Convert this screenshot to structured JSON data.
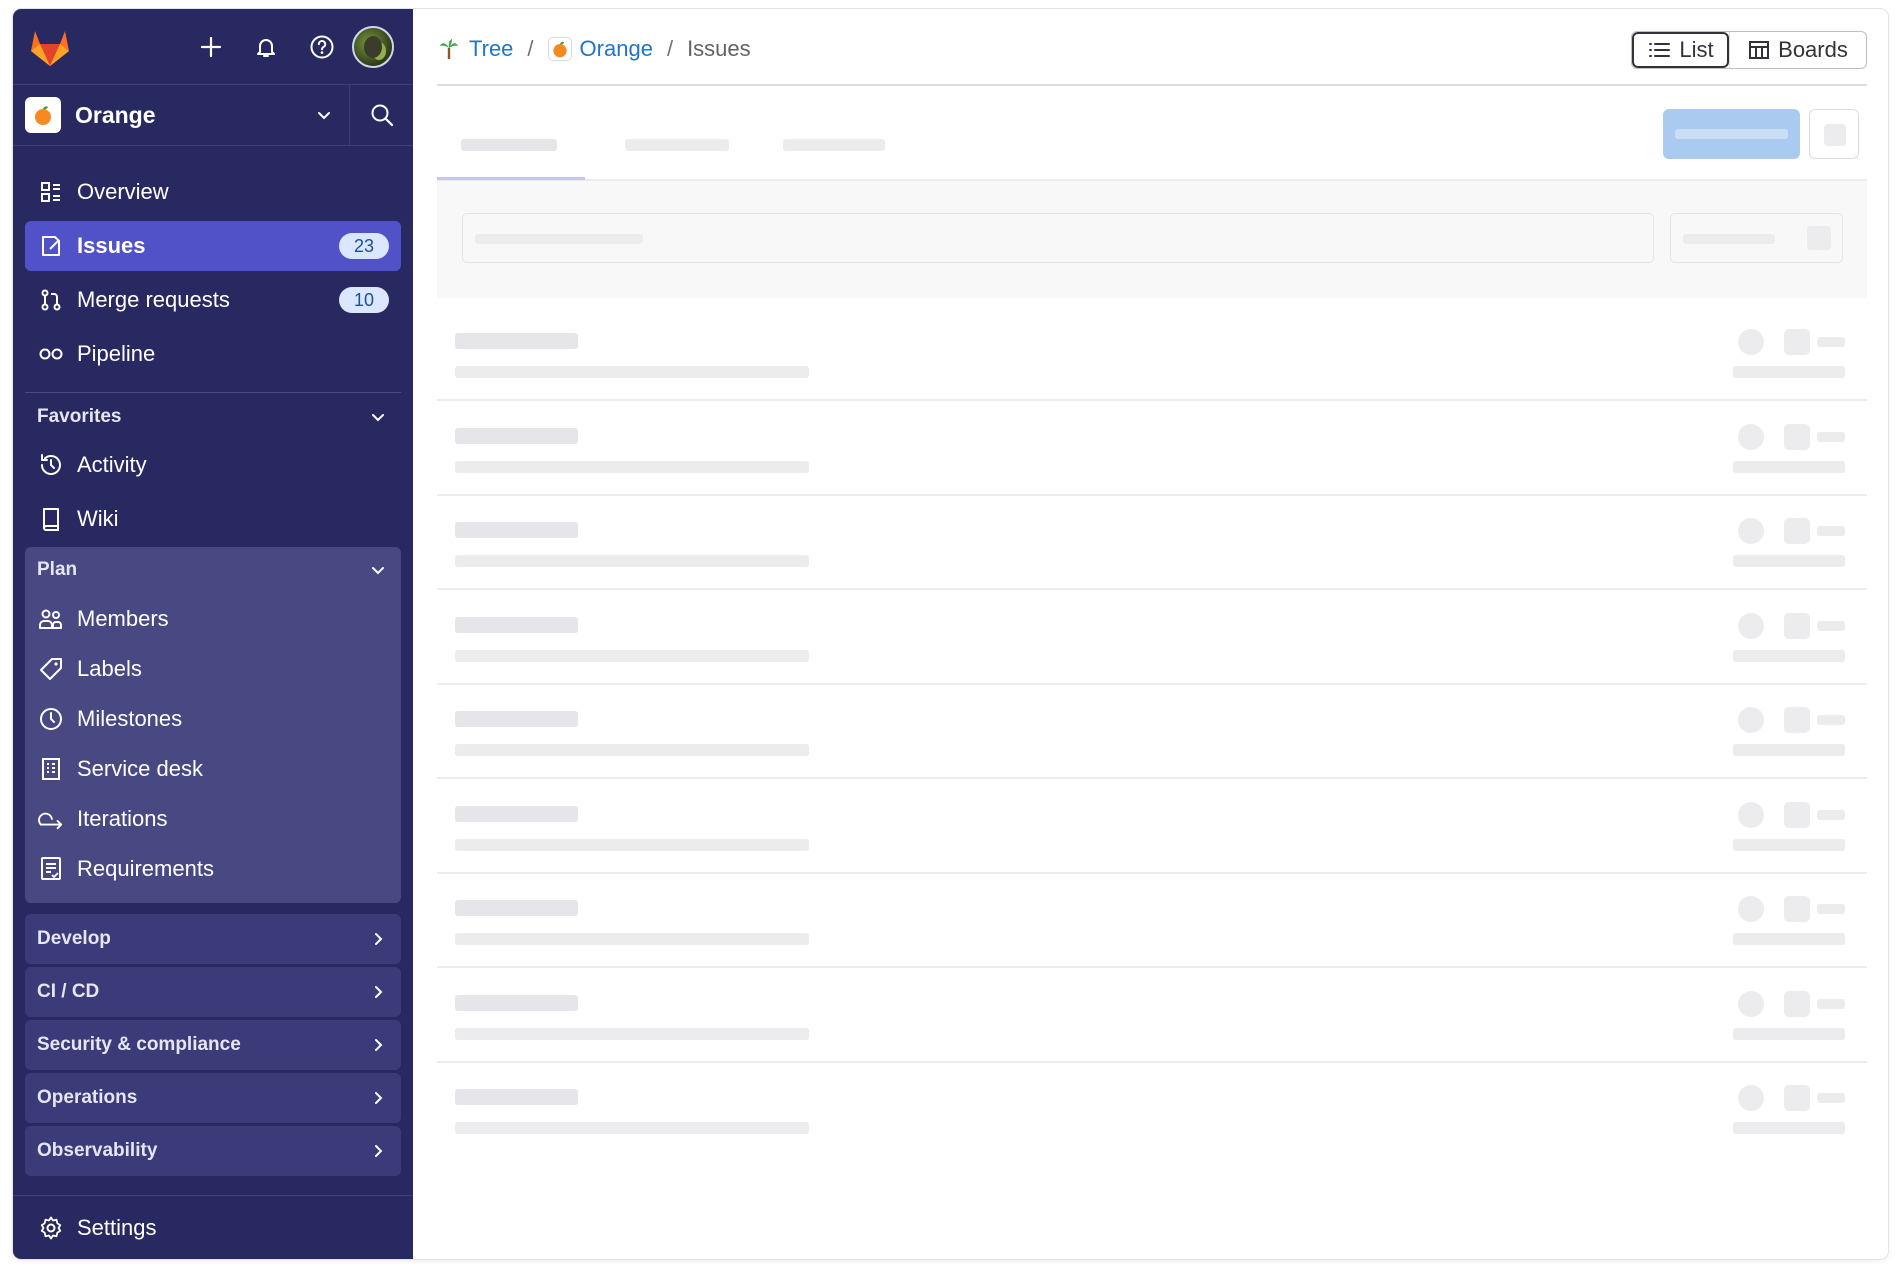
{
  "colors": {
    "sidebar_bg": "#292961",
    "active_item": "#5252c8",
    "section_bg": "#484883",
    "link": "#1f75cb",
    "badge_bg": "#dbe7ff"
  },
  "topbar": {
    "icons": [
      "gitlab-logo",
      "plus-icon",
      "bell-icon",
      "help-icon",
      "user-avatar"
    ]
  },
  "project": {
    "name": "Orange",
    "icon": "orange-emoji"
  },
  "nav": {
    "overview": "Overview",
    "issues": "Issues",
    "issues_count": "23",
    "merge_requests": "Merge requests",
    "merge_requests_count": "10",
    "pipeline": "Pipeline"
  },
  "favorites": {
    "title": "Favorites",
    "activity": "Activity",
    "wiki": "Wiki"
  },
  "plan": {
    "title": "Plan",
    "members": "Members",
    "labels": "Labels",
    "milestones": "Milestones",
    "service_desk": "Service desk",
    "iterations": "Iterations",
    "requirements": "Requirements"
  },
  "collapsed": {
    "develop": "Develop",
    "cicd": "CI / CD",
    "security": "Security & compliance",
    "operations": "Operations",
    "observability": "Observability"
  },
  "settings": "Settings",
  "breadcrumb": {
    "group": "Tree",
    "project": "Orange",
    "current": "Issues",
    "sep": "/"
  },
  "view_toggle": {
    "list": "List",
    "boards": "Boards"
  },
  "skeleton_rows": 9
}
